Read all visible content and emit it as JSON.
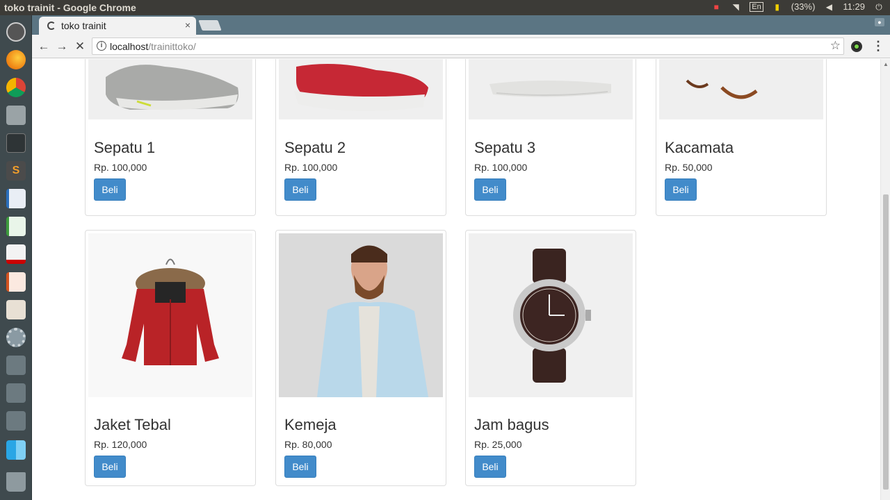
{
  "system_bar": {
    "window_title": "toko trainit - Google Chrome",
    "keyboard_layout": "En",
    "battery": "(33%)",
    "clock": "11:29"
  },
  "browser": {
    "tab_title": "toko trainit",
    "url_host": "localhost",
    "url_path": "/trainittoko/"
  },
  "products_row1": [
    {
      "name": "Sepatu 1",
      "price": "Rp. 100,000",
      "button": "Beli",
      "image": "grey sneaker"
    },
    {
      "name": "Sepatu 2",
      "price": "Rp. 100,000",
      "button": "Beli",
      "image": "red sneaker"
    },
    {
      "name": "Sepatu 3",
      "price": "Rp. 100,000",
      "button": "Beli",
      "image": "white sneaker"
    },
    {
      "name": "Kacamata",
      "price": "Rp. 50,000",
      "button": "Beli",
      "image": "glasses"
    }
  ],
  "products_row2": [
    {
      "name": "Jaket Tebal",
      "price": "Rp. 120,000",
      "button": "Beli",
      "image": "red parka jacket"
    },
    {
      "name": "Kemeja",
      "price": "Rp. 80,000",
      "button": "Beli",
      "image": "man in light blue shirt"
    },
    {
      "name": "Jam bagus",
      "price": "Rp. 25,000",
      "button": "Beli",
      "image": "wrist watch"
    }
  ],
  "colors": {
    "button_primary": "#428bca",
    "tab_strip": "#5b7583",
    "launcher": "#3f4a4e"
  }
}
